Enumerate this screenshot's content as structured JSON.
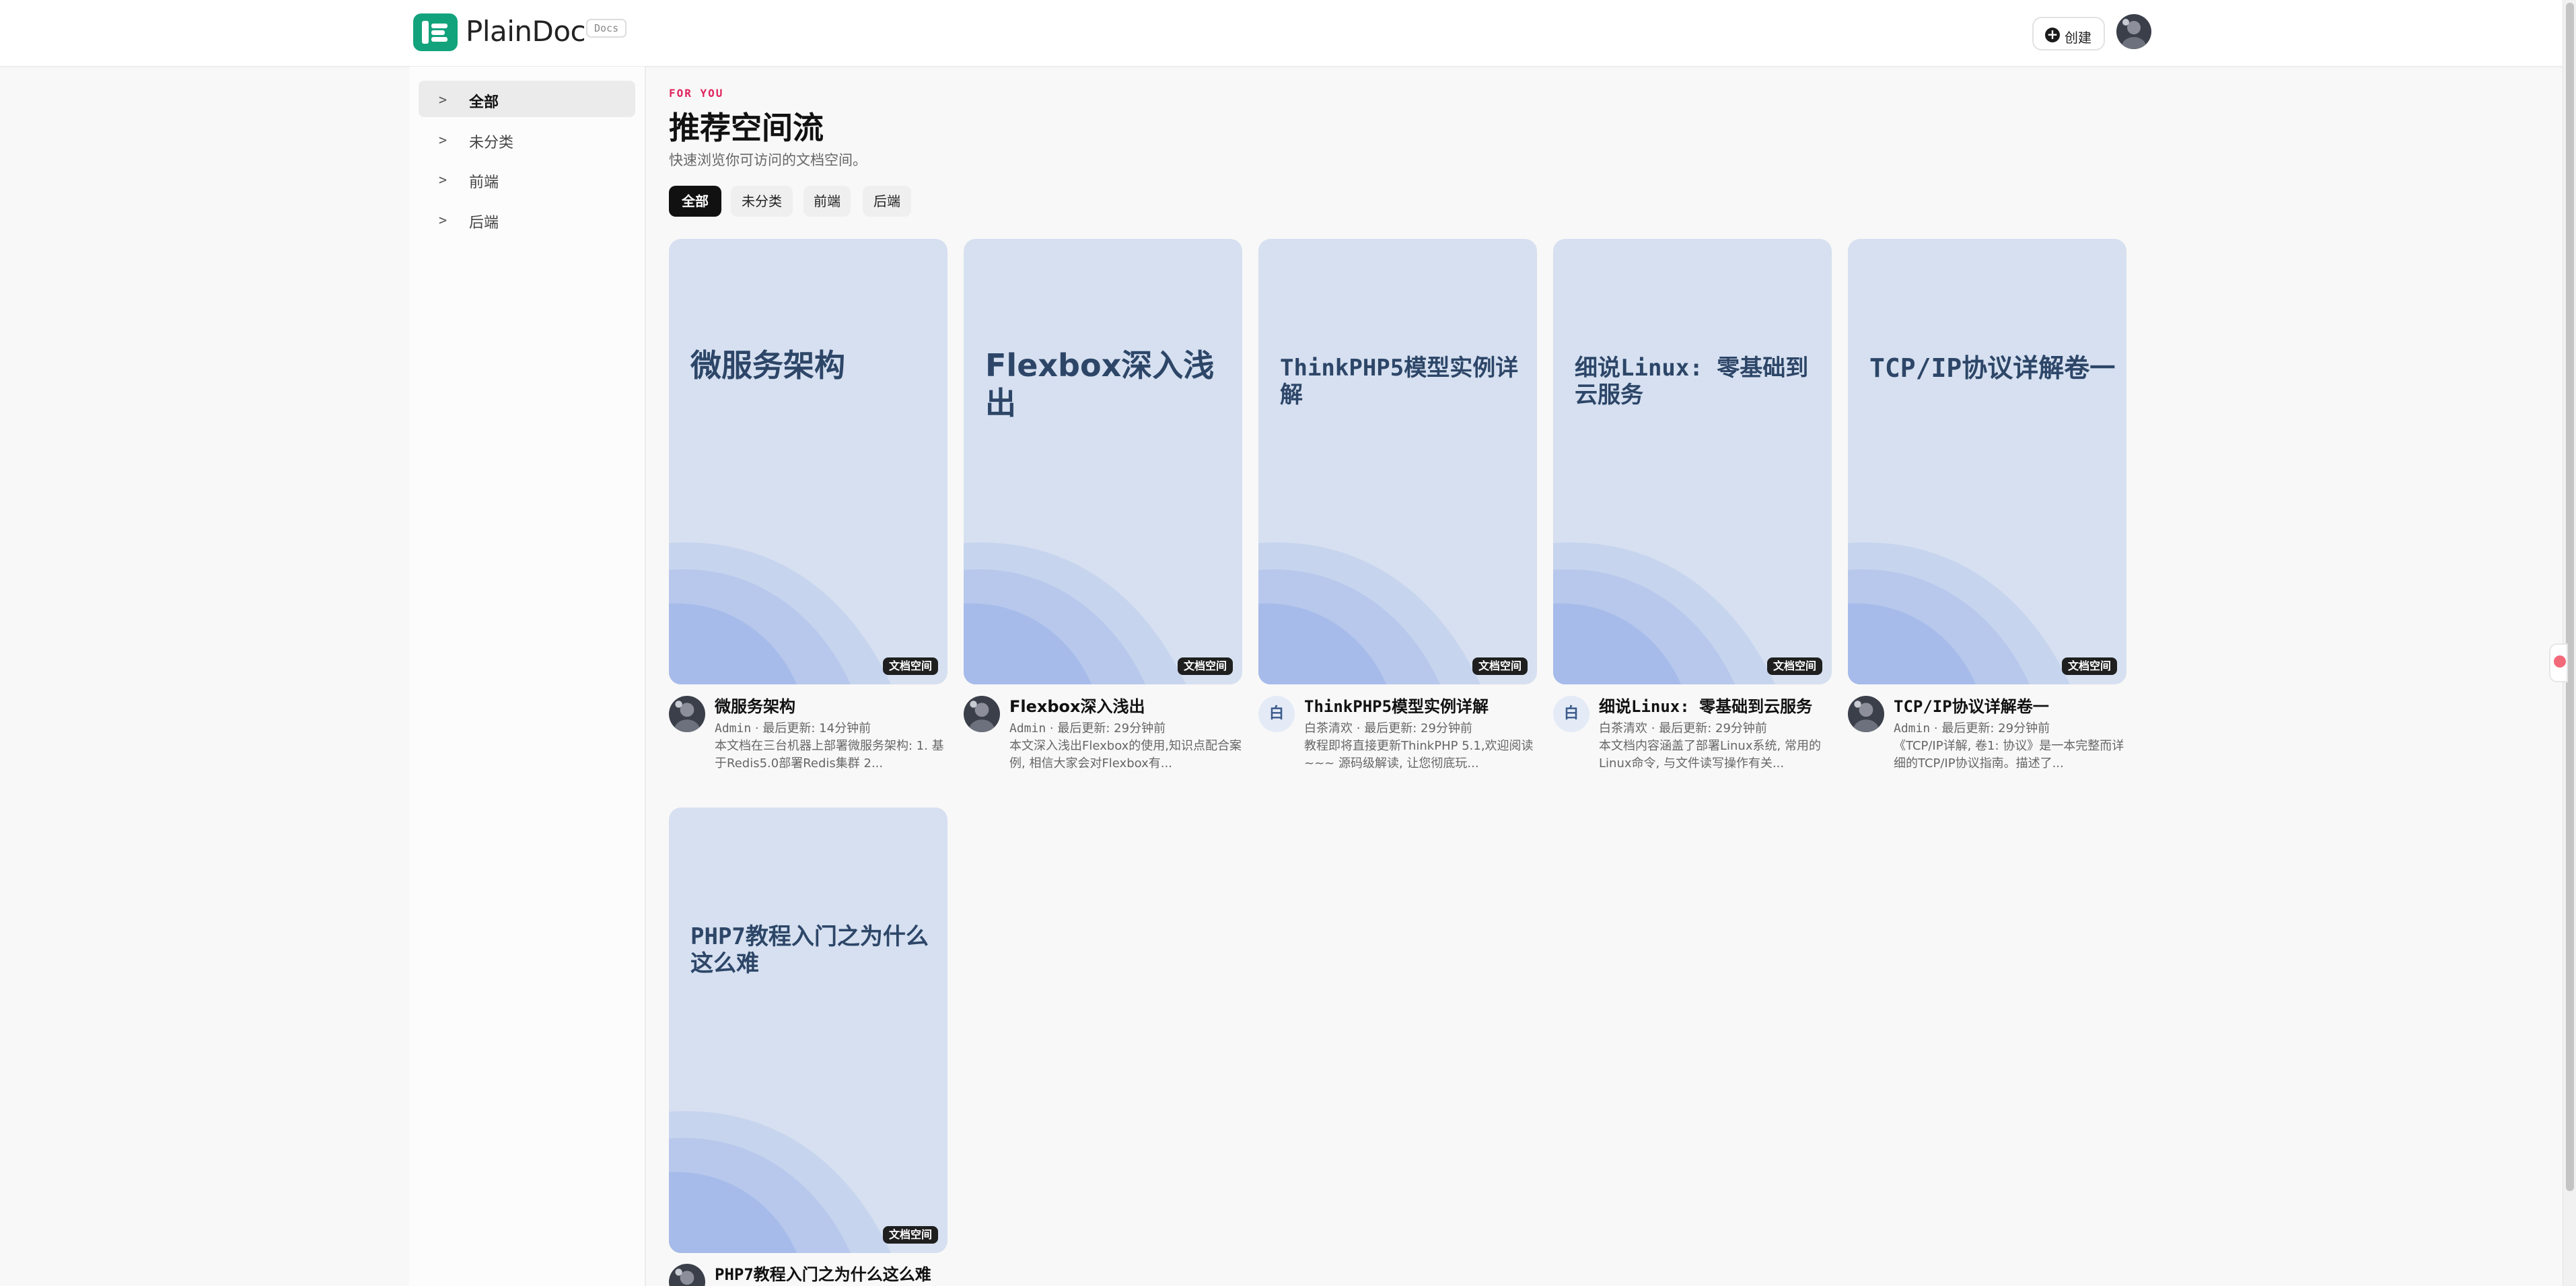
{
  "header": {
    "logo_text": "PlainDoc",
    "docs_badge": "Docs",
    "create_label": "创建"
  },
  "sidebar": {
    "items": [
      {
        "arrow": ">",
        "label": "全部",
        "active": true
      },
      {
        "arrow": ">",
        "label": "未分类",
        "active": false
      },
      {
        "arrow": ">",
        "label": "前端",
        "active": false
      },
      {
        "arrow": ">",
        "label": "后端",
        "active": false
      }
    ]
  },
  "main": {
    "eyebrow": "FOR YOU",
    "title": "推荐空间流",
    "subtitle": "快速浏览你可访问的文档空间。",
    "filters": [
      {
        "label": "全部",
        "active": true
      },
      {
        "label": "未分类",
        "active": false
      },
      {
        "label": "前端",
        "active": false
      },
      {
        "label": "后端",
        "active": false
      }
    ],
    "cards": [
      {
        "cover_title": "微服务架构",
        "badge": "文档空间",
        "title": "微服务架构",
        "author": "Admin",
        "sep": "·",
        "updated": "最后更新: 14分钟前",
        "avatar": "photo",
        "desc": "本文档在三台机器上部署微服务架构: 1. 基于Redis5.0部署Redis集群 2..."
      },
      {
        "cover_title": "Flexbox深入浅出",
        "badge": "文档空间",
        "title": "Flexbox深入浅出",
        "author": "Admin",
        "sep": "·",
        "updated": "最后更新: 29分钟前",
        "avatar": "photo",
        "desc": "本文深入浅出Flexbox的使用,知识点配合案例, 相信大家会对Flexbox有..."
      },
      {
        "cover_title": "ThinkPHP5模型实例详解",
        "badge": "文档空间",
        "title": "ThinkPHP5模型实例详解",
        "author": "白茶清欢",
        "sep": "·",
        "updated": "最后更新: 29分钟前",
        "avatar": "白",
        "desc": "教程即将直接更新ThinkPHP 5.1,欢迎阅读~~~ 源码级解读, 让您彻底玩..."
      },
      {
        "cover_title": "细说Linux: 零基础到云服务",
        "badge": "文档空间",
        "title": "细说Linux: 零基础到云服务",
        "author": "白茶清欢",
        "sep": "·",
        "updated": "最后更新: 29分钟前",
        "avatar": "白",
        "desc": "本文档内容涵盖了部署Linux系统, 常用的Linux命令, 与文件读写操作有关..."
      },
      {
        "cover_title": "TCP/IP协议详解卷一",
        "badge": "文档空间",
        "title": "TCP/IP协议详解卷一",
        "author": "Admin",
        "sep": "·",
        "updated": "最后更新: 29分钟前",
        "avatar": "photo",
        "desc": "《TCP/IP详解, 卷1: 协议》是一本完整而详细的TCP/IP协议指南。描述了..."
      },
      {
        "cover_title": "PHP7教程入门之为什么这么难",
        "badge": "文档空间",
        "title": "PHP7教程入门之为什么这么难",
        "author": "",
        "sep": "",
        "updated": "",
        "avatar": "photo",
        "desc": ""
      }
    ]
  },
  "colors": {
    "accent": "#12a37c",
    "eyebrow": "#e0245e",
    "cover_bg": "#d6e0f0",
    "cover_title": "#2d4668"
  }
}
